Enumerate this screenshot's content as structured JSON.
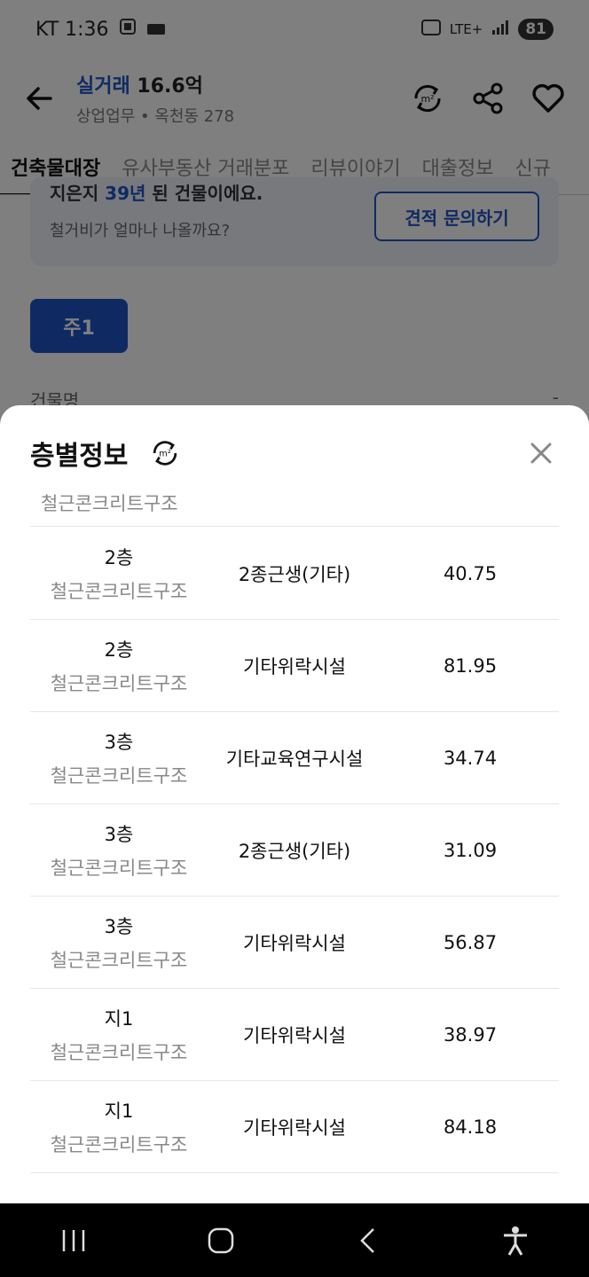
{
  "status_bar": {
    "carrier_time": "KT 1:36",
    "network": "LTE+",
    "battery": "81"
  },
  "header": {
    "title_accent": "실거래",
    "title_value": "16.6억",
    "subtitle": "상업업무 • 옥천동 278"
  },
  "tabs": [
    {
      "label": "건축물대장",
      "active": true
    },
    {
      "label": "유사부동산 거래분포",
      "active": false
    },
    {
      "label": "리뷰이야기",
      "active": false
    },
    {
      "label": "대출정보",
      "active": false
    },
    {
      "label": "신규",
      "active": false
    }
  ],
  "background": {
    "cut_text_prefix": "지은지",
    "cut_text_num": "39년",
    "cut_text_suffix": "된 건물이에요.",
    "question": "철거비가 얼마나 나올까요?",
    "quote_button": "견적 문의하기",
    "main_chip": "주1",
    "field_label": "건물명",
    "field_value": "-"
  },
  "sheet": {
    "title": "층별정보",
    "clipped_row_text": "철근콘크리트구조",
    "rows": [
      {
        "floor": "2층",
        "structure": "철근콘크리트구조",
        "use": "2종근생(기타)",
        "area": "40.75"
      },
      {
        "floor": "2층",
        "structure": "철근콘크리트구조",
        "use": "기타위락시설",
        "area": "81.95"
      },
      {
        "floor": "3층",
        "structure": "철근콘크리트구조",
        "use": "기타교육연구시설",
        "area": "34.74"
      },
      {
        "floor": "3층",
        "structure": "철근콘크리트구조",
        "use": "2종근생(기타)",
        "area": "31.09"
      },
      {
        "floor": "3층",
        "structure": "철근콘크리트구조",
        "use": "기타위락시설",
        "area": "56.87"
      },
      {
        "floor": "지1",
        "structure": "철근콘크리트구조",
        "use": "기타위락시설",
        "area": "38.97"
      },
      {
        "floor": "지1",
        "structure": "철근콘크리트구조",
        "use": "기타위락시설",
        "area": "84.18"
      }
    ]
  },
  "icons": {
    "back": "arrow-left-icon",
    "unit_toggle": "area-unit-toggle-icon",
    "share": "share-icon",
    "favorite": "heart-icon",
    "close": "close-icon"
  },
  "colors": {
    "accent": "#1f55c7",
    "scrim": "rgba(0,0,0,0.5)"
  }
}
